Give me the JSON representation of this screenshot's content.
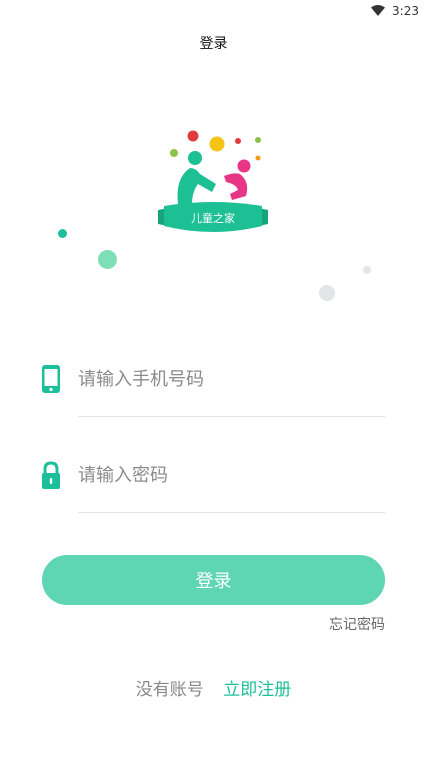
{
  "status_bar": {
    "time": "3:23",
    "wifi_icon": "wifi-icon"
  },
  "header": {
    "title": "登录"
  },
  "logo": {
    "text": "儿童之家",
    "colors": {
      "green": "#1dbf94",
      "pink": "#e83585",
      "red": "#e23b3b",
      "yellow": "#f7c415"
    }
  },
  "form": {
    "phone": {
      "icon": "phone-icon",
      "placeholder": "请输入手机号码",
      "value": ""
    },
    "password": {
      "icon": "lock-icon",
      "placeholder": "请输入密码",
      "value": ""
    }
  },
  "actions": {
    "login_label": "登录",
    "forgot_password": "忘记密码",
    "no_account": "没有账号",
    "register": "立即注册"
  },
  "colors": {
    "accent": "#1cbf99",
    "button": "#5ed5b3",
    "placeholder": "#8a8a8a"
  }
}
